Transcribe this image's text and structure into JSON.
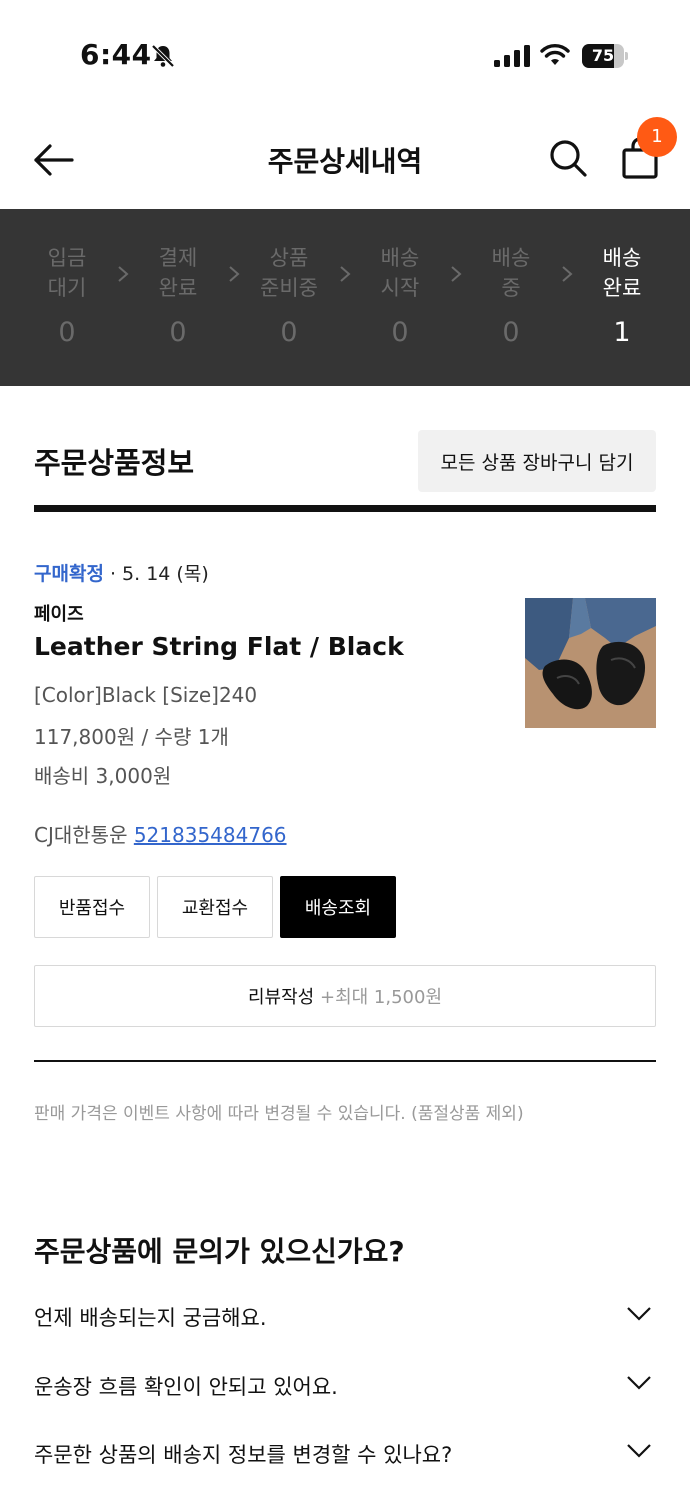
{
  "status_bar": {
    "time": "6:44",
    "battery_level": "75",
    "battery_fraction": 0.75
  },
  "header": {
    "title": "주문상세내역",
    "cart_badge": "1"
  },
  "progress": {
    "steps": [
      {
        "label": "입금\n대기",
        "count": "0",
        "active": false
      },
      {
        "label": "결제\n완료",
        "count": "0",
        "active": false
      },
      {
        "label": "상품\n준비중",
        "count": "0",
        "active": false
      },
      {
        "label": "배송\n시작",
        "count": "0",
        "active": false
      },
      {
        "label": "배송\n중",
        "count": "0",
        "active": false
      },
      {
        "label": "배송\n완료",
        "count": "1",
        "active": true
      }
    ]
  },
  "section": {
    "title": "주문상품정보",
    "cart_all_label": "모든 상품 장바구니 담기"
  },
  "order": {
    "status": "구매확정",
    "date": "· 5. 14 (목)",
    "brand": "페이즈",
    "product_name": "Leather String Flat / Black",
    "option": "[Color]Black [Size]240",
    "price": "117,800원 / 수량 1개",
    "shipping_fee": "배송비 3,000원",
    "courier": "CJ대한통운",
    "tracking_number": "521835484766",
    "buttons": {
      "return": "반품접수",
      "exchange": "교환접수",
      "track": "배송조회"
    },
    "review_label": "리뷰작성",
    "review_bonus": "+최대 1,500원"
  },
  "notice": "판매 가격은 이벤트 사항에 따라 변경될 수 있습니다. (품절상품 제외)",
  "faq": {
    "title": "주문상품에 문의가 있으신가요?",
    "items": [
      "언제 배송되는지 궁금해요.",
      "운송장 흐름 확인이 안되고 있어요.",
      "주문한 상품의 배송지 정보를 변경할 수 있나요?"
    ]
  }
}
